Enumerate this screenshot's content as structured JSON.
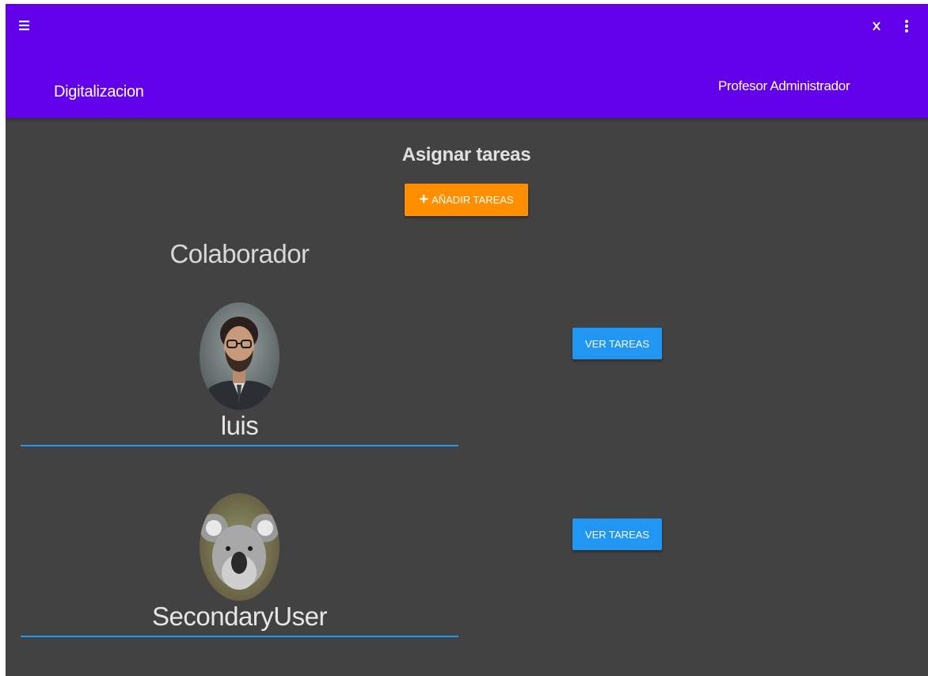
{
  "app_bar": {
    "title": "Digitalizacion",
    "user": "Profesor Administrador",
    "close_label": "X",
    "background": "#6200ea"
  },
  "main": {
    "heading": "Asignar tareas",
    "add_button_label": "AÑADIR TAREAS",
    "add_button_icon": "plus-icon",
    "add_button_color": "#ff8f00",
    "section_heading": "Colaborador",
    "collaborators": [
      {
        "name": "luis",
        "avatar": "man-with-glasses-photo",
        "action_label": "VER TAREAS"
      },
      {
        "name": "SecondaryUser",
        "avatar": "koala-photo",
        "action_label": "VER TAREAS"
      }
    ],
    "action_color": "#2196f3",
    "background": "#424242"
  },
  "icons": {
    "menu": "menu-icon",
    "close": "close-icon",
    "more": "more-vertical-icon"
  }
}
